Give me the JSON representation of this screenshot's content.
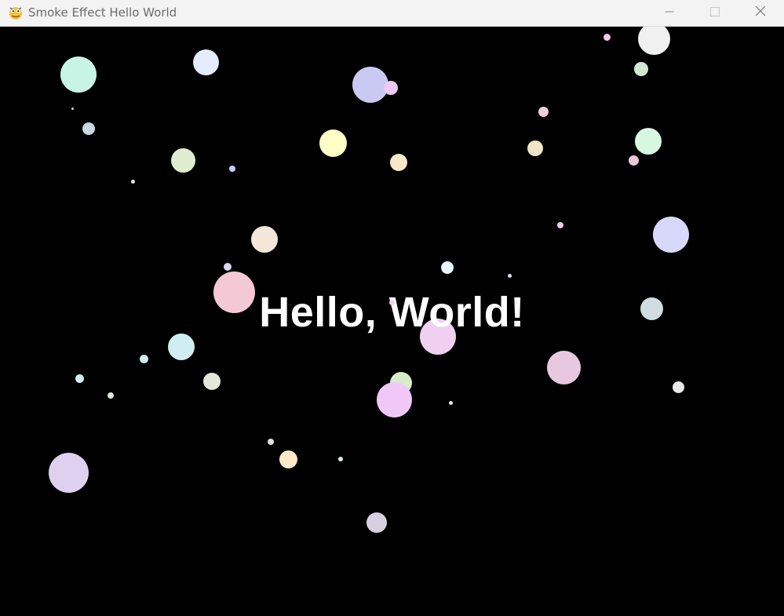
{
  "window": {
    "title": "Smoke Effect Hello World",
    "app_icon": "pygame-snake-icon",
    "controls": {
      "minimize_icon": "minimize-icon",
      "maximize_icon": "maximize-icon",
      "close_icon": "close-icon"
    }
  },
  "canvas": {
    "background": "#000000",
    "text": "Hello, World!",
    "text_color": "#ffffff"
  },
  "particle_colors": [
    "#c8f4e6",
    "#e6ecff",
    "#c9c9f2",
    "#f0c8f5",
    "#f6f6f6",
    "#cfe9d4",
    "#f7e6ec",
    "#c8d8d8",
    "#e0ecd0",
    "#ffffc8",
    "#f7e8c8",
    "#f0e6c8",
    "#d7f7e0",
    "#e8c8d8",
    "#d8d8fa",
    "#e0e0e0",
    "#f4e6d8",
    "#f4c8d4",
    "#d0eef2",
    "#e4e8d8",
    "#f0d0f0",
    "#d8ecc8",
    "#e8c8e8",
    "#ffe8c8",
    "#e0d0f0",
    "#d8d0e0"
  ]
}
